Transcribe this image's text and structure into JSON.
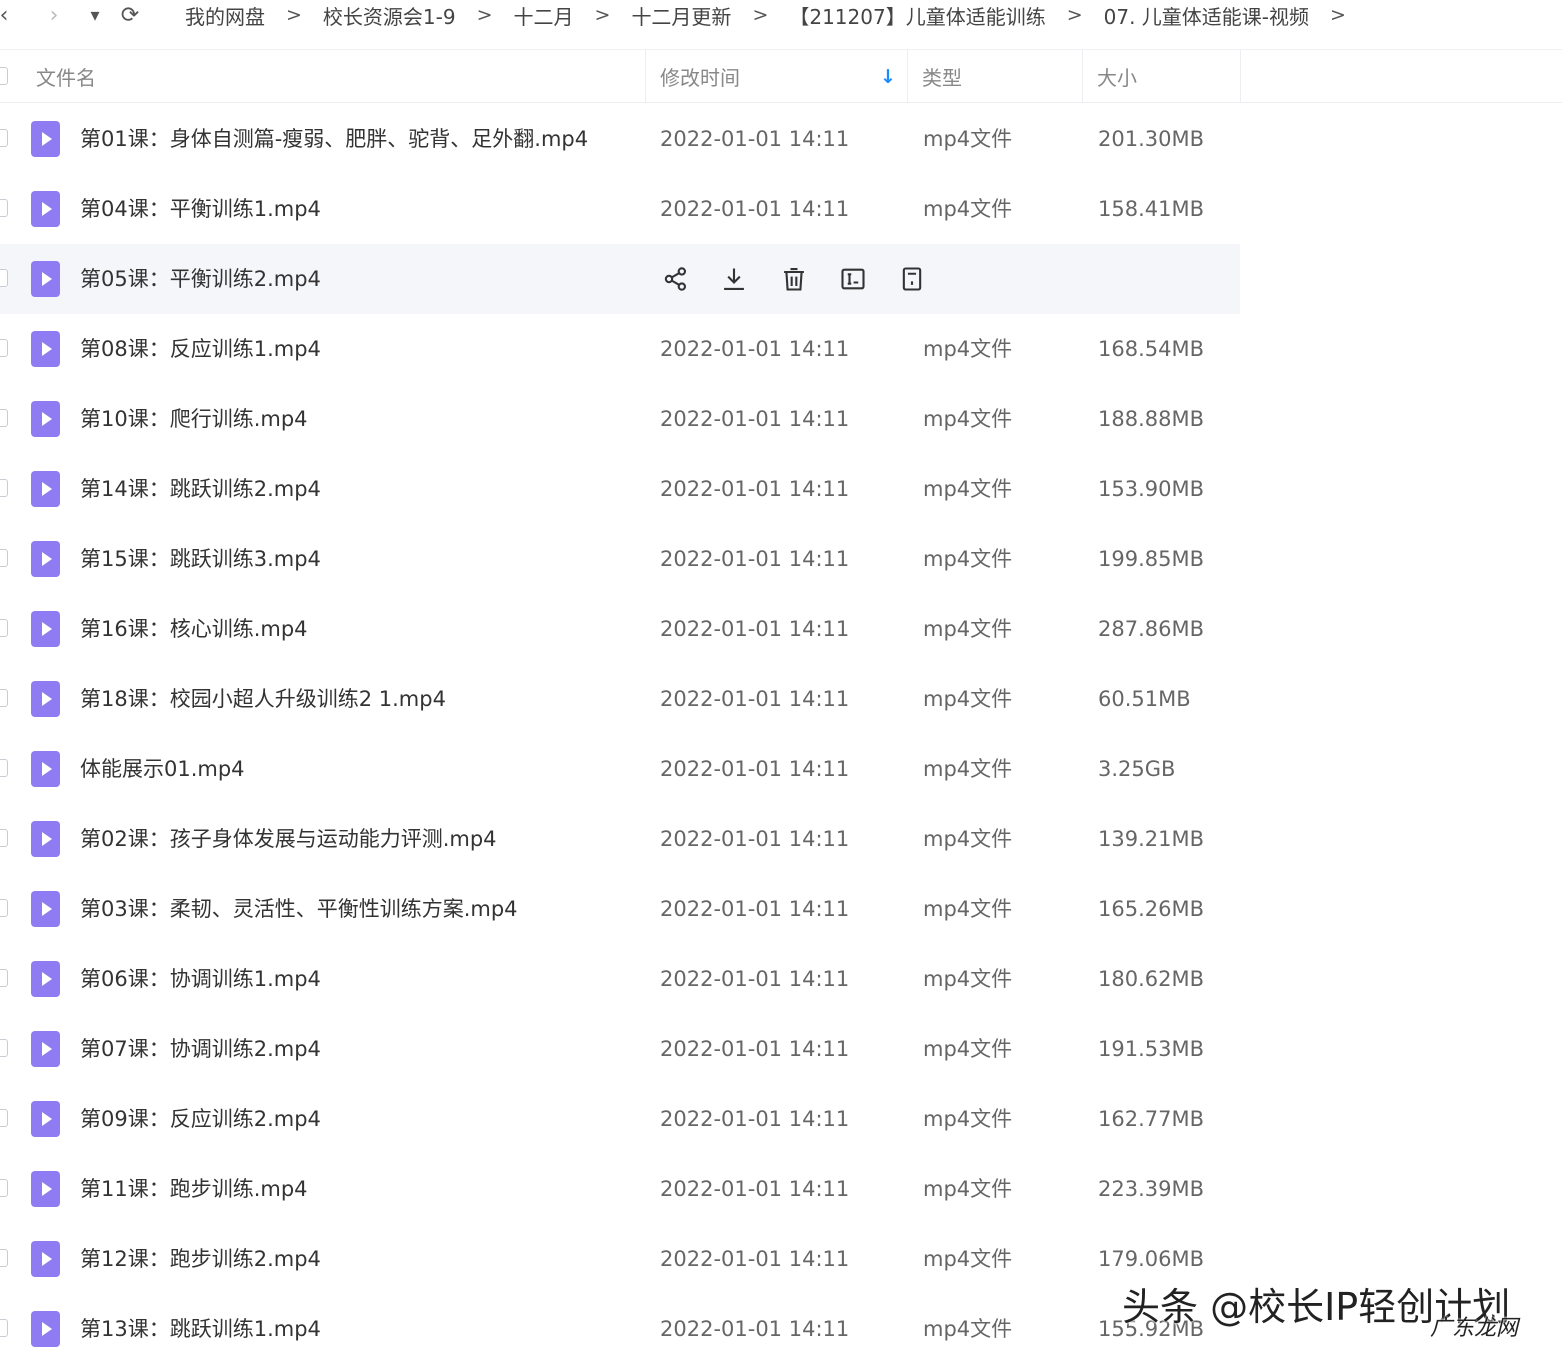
{
  "nav": {
    "back": "‹",
    "forward": "›",
    "dropdown": "▾",
    "refresh": "⟳"
  },
  "breadcrumb": [
    "我的网盘",
    "校长资源会1-9",
    "十二月",
    "十二月更新",
    "【211207】儿童体适能训练",
    "07. 儿童体适能课-视频"
  ],
  "breadcrumb_separator": ">",
  "columns": {
    "name": "文件名",
    "modified": "修改时间",
    "type": "类型",
    "size": "大小",
    "sort_indicator": "↓"
  },
  "files": [
    {
      "name": "第01课：身体自测篇-瘦弱、肥胖、驼背、足外翻.mp4",
      "date": "2022-01-01 14:11",
      "type": "mp4文件",
      "size": "201.30MB"
    },
    {
      "name": "第04课：平衡训练1.mp4",
      "date": "2022-01-01 14:11",
      "type": "mp4文件",
      "size": "158.41MB"
    },
    {
      "name": "第05课：平衡训练2.mp4",
      "date": "",
      "type": "",
      "size": "",
      "hovered": true
    },
    {
      "name": "第08课：反应训练1.mp4",
      "date": "2022-01-01 14:11",
      "type": "mp4文件",
      "size": "168.54MB"
    },
    {
      "name": "第10课：爬行训练.mp4",
      "date": "2022-01-01 14:11",
      "type": "mp4文件",
      "size": "188.88MB"
    },
    {
      "name": "第14课：跳跃训练2.mp4",
      "date": "2022-01-01 14:11",
      "type": "mp4文件",
      "size": "153.90MB"
    },
    {
      "name": "第15课：跳跃训练3.mp4",
      "date": "2022-01-01 14:11",
      "type": "mp4文件",
      "size": "199.85MB"
    },
    {
      "name": "第16课：核心训练.mp4",
      "date": "2022-01-01 14:11",
      "type": "mp4文件",
      "size": "287.86MB"
    },
    {
      "name": "第18课：校园小超人升级训练2 1.mp4",
      "date": "2022-01-01 14:11",
      "type": "mp4文件",
      "size": "60.51MB"
    },
    {
      "name": "体能展示01.mp4",
      "date": "2022-01-01 14:11",
      "type": "mp4文件",
      "size": "3.25GB"
    },
    {
      "name": "第02课：孩子身体发展与运动能力评测.mp4",
      "date": "2022-01-01 14:11",
      "type": "mp4文件",
      "size": "139.21MB"
    },
    {
      "name": "第03课：柔韧、灵活性、平衡性训练方案.mp4",
      "date": "2022-01-01 14:11",
      "type": "mp4文件",
      "size": "165.26MB"
    },
    {
      "name": "第06课：协调训练1.mp4",
      "date": "2022-01-01 14:11",
      "type": "mp4文件",
      "size": "180.62MB"
    },
    {
      "name": "第07课：协调训练2.mp4",
      "date": "2022-01-01 14:11",
      "type": "mp4文件",
      "size": "191.53MB"
    },
    {
      "name": "第09课：反应训练2.mp4",
      "date": "2022-01-01 14:11",
      "type": "mp4文件",
      "size": "162.77MB"
    },
    {
      "name": "第11课：跑步训练.mp4",
      "date": "2022-01-01 14:11",
      "type": "mp4文件",
      "size": "223.39MB"
    },
    {
      "name": "第12课：跑步训练2.mp4",
      "date": "2022-01-01 14:11",
      "type": "mp4文件",
      "size": "179.06MB"
    },
    {
      "name": "第13课：跳跃训练1.mp4",
      "date": "2022-01-01 14:11",
      "type": "mp4文件",
      "size": "155.92MB"
    }
  ],
  "row_actions": [
    "share-icon",
    "download-icon",
    "delete-icon",
    "rename-icon",
    "more-icon"
  ],
  "watermark": {
    "main": "头条 @校长IP轻创计划",
    "sub": "广东龙网"
  },
  "colors": {
    "file_icon": "#8f7cf2",
    "sort_arrow": "#1a8cff",
    "hover_row": "#f5f6f9"
  }
}
